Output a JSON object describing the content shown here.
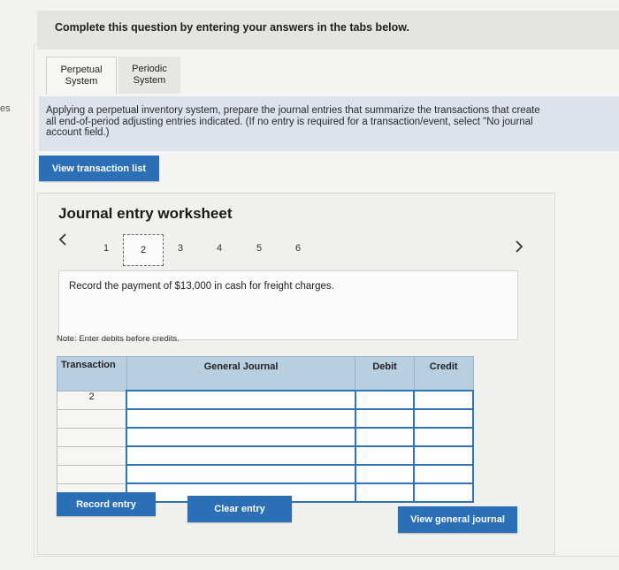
{
  "header": {
    "title": "Complete this question by entering your answers in the tabs below."
  },
  "side_text": "es",
  "tabs": [
    {
      "label": "Perpetual System",
      "active": true
    },
    {
      "label": "Periodic System",
      "active": false
    }
  ],
  "instructions": {
    "line1": "Applying a perpetual inventory system, prepare the journal entries that summarize the transactions that create",
    "line2": "all end-of-period adjusting entries indicated. (If no entry is required for a transaction/event, select \"No journal",
    "line3": "account field.)"
  },
  "view_transaction_list_label": "View transaction list",
  "worksheet": {
    "title": "Journal entry worksheet",
    "prev_icon": "chevron-left-icon",
    "next_icon": "chevron-right-icon",
    "pages": [
      "1",
      "2",
      "3",
      "4",
      "5",
      "6"
    ],
    "current_page": "2",
    "description": "Record the payment of $13,000 in cash for freight charges.",
    "note": "Note: Enter debits before credits."
  },
  "table": {
    "headers": {
      "transaction": "Transaction",
      "general_journal": "General Journal",
      "debit": "Debit",
      "credit": "Credit"
    },
    "rows": [
      {
        "transaction": "2",
        "account": "",
        "debit": "",
        "credit": ""
      },
      {
        "transaction": "",
        "account": "",
        "debit": "",
        "credit": ""
      },
      {
        "transaction": "",
        "account": "",
        "debit": "",
        "credit": ""
      },
      {
        "transaction": "",
        "account": "",
        "debit": "",
        "credit": ""
      },
      {
        "transaction": "",
        "account": "",
        "debit": "",
        "credit": ""
      },
      {
        "transaction": "",
        "account": "",
        "debit": "",
        "credit": ""
      }
    ]
  },
  "buttons": {
    "record_entry": "Record entry",
    "clear_entry": "Clear entry",
    "view_general_journal": "View general journal"
  },
  "colors": {
    "accent": "#2b6fb6",
    "table_header": "#b8cfe2",
    "instructions_bg": "#dce3ea"
  }
}
